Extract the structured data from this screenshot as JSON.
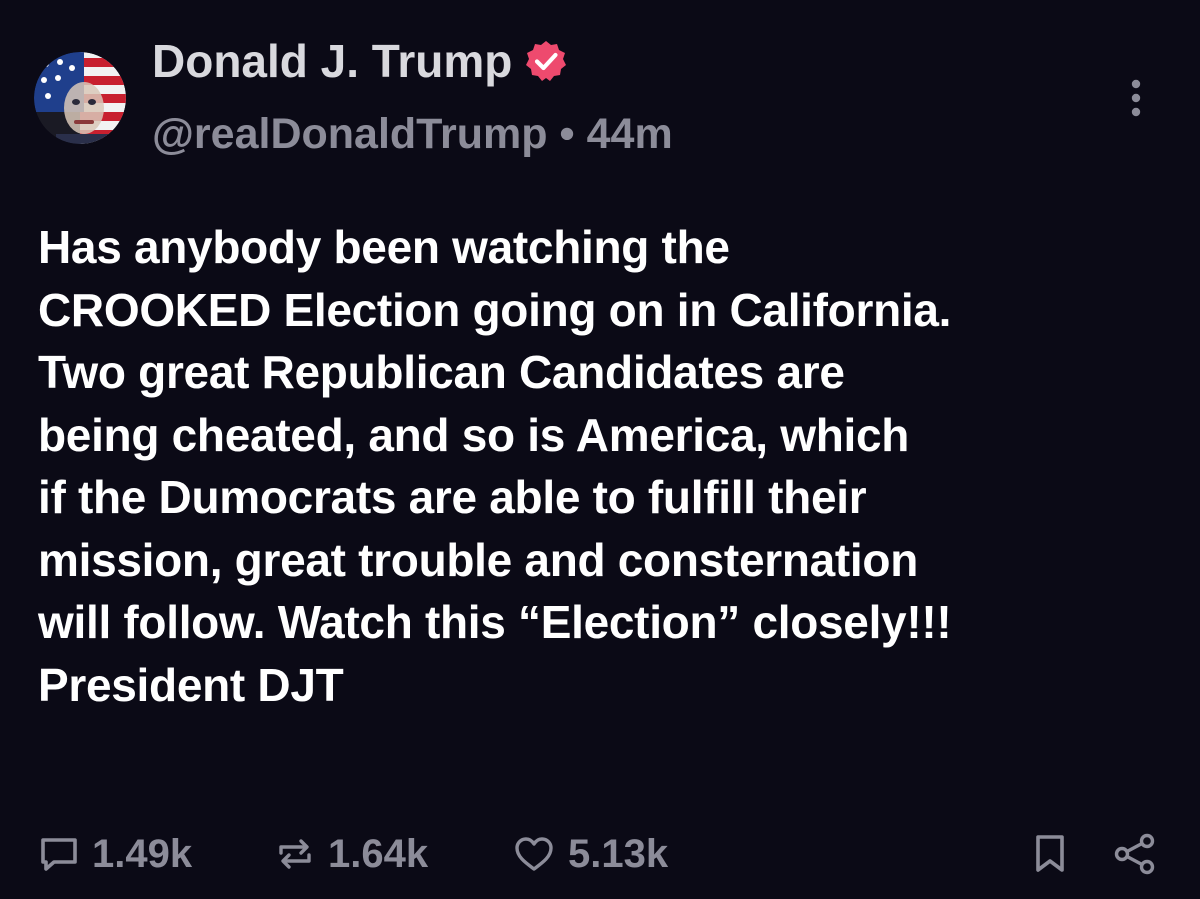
{
  "post": {
    "author": {
      "display_name": "Donald J. Trump",
      "handle": "@realDonaldTrump",
      "time_ago": "44m",
      "separator": "•",
      "verified": true,
      "verified_color": "#ee4a6e"
    },
    "text": "Has anybody been watching the\nCROOKED Election going on in California.\nTwo great Republican Candidates are\nbeing cheated, and so is America, which\nif the Dumocrats are able to fulfill their\nmission, great trouble and consternation\nwill follow. Watch this “Election” closely!!!\nPresident DJT",
    "actions": {
      "replies": "1.49k",
      "reposts": "1.64k",
      "likes": "5.13k"
    },
    "icons": {
      "more": "more-vertical-icon",
      "reply": "comment-icon",
      "repost": "repost-icon",
      "like": "heart-icon",
      "bookmark": "bookmark-icon",
      "share": "share-icon"
    }
  },
  "colors": {
    "background": "#0b0a16",
    "primary_text": "#ffffff",
    "name_text": "#d9d9de",
    "secondary_text": "#8c8c99"
  }
}
